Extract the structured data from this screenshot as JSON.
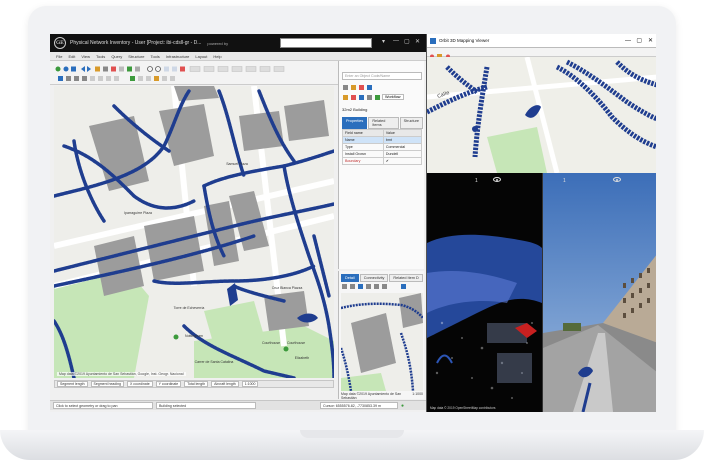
{
  "app": {
    "title": "Physical Network Inventory - User [Project: ibi-cdsll-gr - D...",
    "powered_by": "powered by",
    "logo_text": "GE",
    "window_controls": [
      "▾",
      "—",
      "▢",
      "✕"
    ]
  },
  "menu": [
    "File",
    "Edit",
    "View",
    "Tools",
    "Query",
    "Structure",
    "Tools",
    "Infrastructure",
    "Layout",
    "Help"
  ],
  "side_panel": {
    "search_placeholder": "Enter an Object Code/Name",
    "dropdown_value": "Workflow",
    "selection_label": "32m2 Building",
    "tabs": [
      "Properties",
      "Related Items",
      "Structure"
    ],
    "table_headers": [
      "Field name",
      "Value"
    ],
    "rows": [
      {
        "field": "Name",
        "value": "bmt"
      },
      {
        "field": "Type",
        "value": "Commercial"
      },
      {
        "field": "Install Grown",
        "value": "Dundell"
      },
      {
        "field": "Boundary",
        "value": "✔"
      }
    ]
  },
  "small_pane": {
    "tabs": [
      "Detail",
      "Connectivity",
      "Related Item D"
    ],
    "attribution": "Map data ©2019 Ayuntamiento de San Sebastián",
    "scale": "1:1000"
  },
  "map_main": {
    "attribution": "Map data ©2019 Ayuntamiento de San Sebastián, Google, Inst. Geogr. Nacional",
    "labels": [
      "Samuel Plaza",
      "Iparraguirre Plaza",
      "Cruz Blanca Piazza",
      "Courthouse",
      "Courthouse",
      "Torre de Echeverría",
      "Nottingham",
      "Elizabeth",
      "Carrer de Santa Catalina"
    ]
  },
  "status_left": {
    "fields": [
      "Segment length",
      "Segment heading",
      "X coordinate",
      "Y coordinate",
      "Total length",
      "Aircraft length"
    ],
    "scale_value": "1:1000"
  },
  "bottom_status": {
    "left": "Click to select geometry or drag to pan",
    "middle": "Building selected",
    "coords": "Cursor: 6555576.82, -7730853.39 m",
    "ready": "●"
  },
  "viewer": {
    "title": "Orbit 3D Mapping Viewer",
    "pane1_num": "1",
    "pane2_num": "1",
    "attribution": "Map data © 2019 OpenStreetMap contributors"
  },
  "colors": {
    "network_blue": "#1f3d8f",
    "building_grey": "#9c9c9c",
    "park_green": "#c6e6b7",
    "selected_tab": "#2a6ebd"
  }
}
